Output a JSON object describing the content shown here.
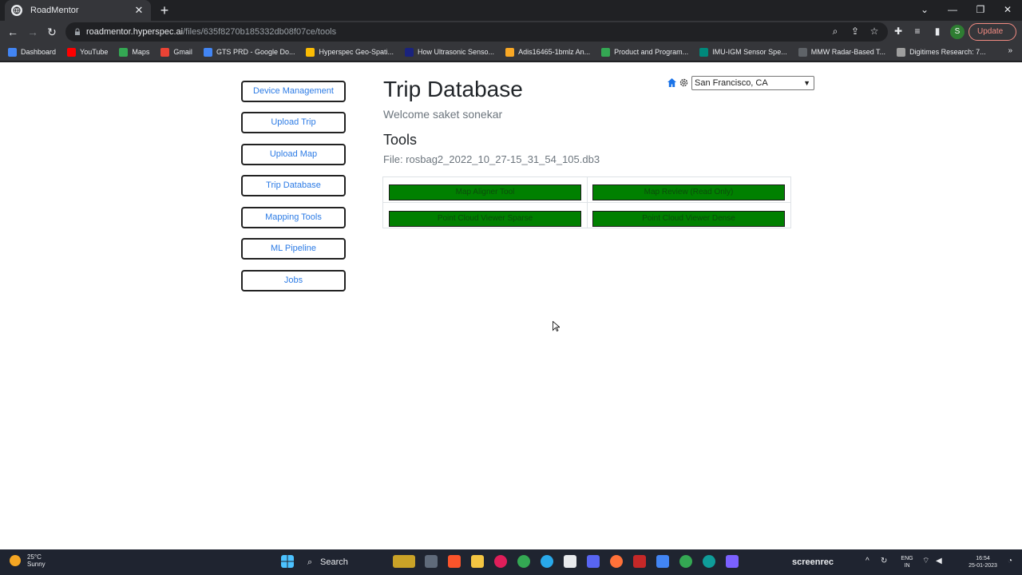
{
  "browser": {
    "tab_title": "RoadMentor",
    "tab_close": "✕",
    "new_tab": "+",
    "url_host": "roadmentor.hyperspec.ai",
    "url_path": "/files/635f8270b185332db08f07ce/tools",
    "profile_initial": "S",
    "update_label": "Update",
    "bookmarks": [
      {
        "label": "Dashboard",
        "color": "#4285f4"
      },
      {
        "label": "YouTube",
        "color": "#ff0000"
      },
      {
        "label": "Maps",
        "color": "#34a853"
      },
      {
        "label": "Gmail",
        "color": "#ea4335"
      },
      {
        "label": "GTS PRD - Google Do...",
        "color": "#4285f4"
      },
      {
        "label": "Hyperspec Geo-Spati...",
        "color": "#fbbc04"
      },
      {
        "label": "How Ultrasonic Senso...",
        "color": "#1a237e"
      },
      {
        "label": "Adis16465-1bmlz An...",
        "color": "#f9a825"
      },
      {
        "label": "Product and Program...",
        "color": "#34a853"
      },
      {
        "label": "IMU-IGM Sensor Spe...",
        "color": "#00897b"
      },
      {
        "label": "MMW Radar-Based T...",
        "color": "#5f6368"
      },
      {
        "label": "Digitimes Research: 7...",
        "color": "#9e9e9e"
      }
    ],
    "bookmarks_more": "»"
  },
  "sidebar": {
    "items": [
      {
        "label": "Device Management"
      },
      {
        "label": "Upload Trip"
      },
      {
        "label": "Upload Map"
      },
      {
        "label": "Trip Database"
      },
      {
        "label": "Mapping Tools"
      },
      {
        "label": "ML Pipeline"
      },
      {
        "label": "Jobs"
      }
    ]
  },
  "main": {
    "title": "Trip Database",
    "welcome": "Welcome saket sonekar",
    "tools_heading": "Tools",
    "file_line": "File: rosbag2_2022_10_27-15_31_54_105.db3",
    "tools": [
      {
        "label": "Map Aligner Tool"
      },
      {
        "label": "Map Review (Read Only)"
      },
      {
        "label": "Point Cloud Viewer Sparse"
      },
      {
        "label": "Point Cloud Viewer Dense"
      }
    ],
    "city_selected": "San Francisco, CA"
  },
  "taskbar": {
    "temperature": "25°C",
    "weather": "Sunny",
    "search_label": "Search",
    "lang": "ENG",
    "region": "IN",
    "time": "16:54",
    "date": "25-01-2023",
    "screenrec": "screenrec"
  },
  "colors": {
    "tool_button": "#008000",
    "link_blue": "#2c7be5",
    "chrome_dark": "#202124"
  }
}
